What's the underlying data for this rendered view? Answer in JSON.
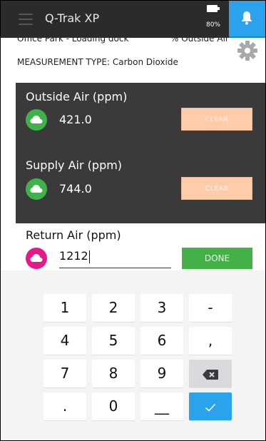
{
  "header": {
    "title": "Q-Trak XP",
    "battery_percent": "80%",
    "accent_color": "#2aa2ec"
  },
  "info": {
    "location": "Office Park - Loading dock",
    "air_type": "% Outside Air",
    "measurement_type": "MEASUREMENT TYPE: Carbon Dioxide"
  },
  "readings": {
    "outside": {
      "label": "Outside Air (ppm)",
      "value": "421.0",
      "clear_label": "CLEAR"
    },
    "supply": {
      "label": "Supply Air (ppm)",
      "value": "744.0",
      "clear_label": "CLEAR"
    },
    "return": {
      "label": "Return Air (ppm)",
      "value": "1212",
      "done_label": "DONE"
    }
  },
  "keypad": {
    "keys": [
      "1",
      "2",
      "3",
      "-",
      "4",
      "5",
      "6",
      ",",
      "7",
      "8",
      "9",
      "backspace",
      ".",
      "0",
      "_",
      "check"
    ],
    "labels": {
      "k1": "1",
      "k2": "2",
      "k3": "3",
      "kminus": "-",
      "k4": "4",
      "k5": "5",
      "k6": "6",
      "kcomma": ",",
      "k7": "7",
      "k8": "8",
      "k9": "9",
      "kdot": ".",
      "k0": "0",
      "kunderscore": "__"
    }
  }
}
